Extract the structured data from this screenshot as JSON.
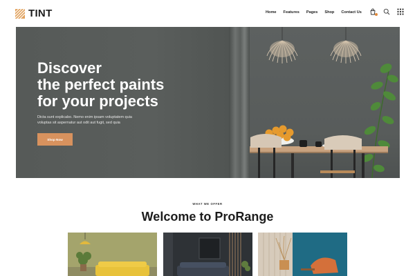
{
  "header": {
    "logo_text": "TINT",
    "nav": [
      "Home",
      "Features",
      "Pages",
      "Shop",
      "Contact Us"
    ],
    "icons": [
      "shopping-bag-icon",
      "search-icon",
      "grid-menu-icon"
    ]
  },
  "hero": {
    "title_lines": [
      "Discover",
      "the perfect paints",
      "for your projects"
    ],
    "description_lines": [
      "Dicta sunt explicabo. Nemo enim ipsam voluptatem quia",
      "voluptas sit aspernatur aut odit aut fugit, sed quia"
    ],
    "button_label": "Shop Now"
  },
  "offer": {
    "eyebrow": "WHAT WE OFFER",
    "title": "Welcome to ProRange"
  },
  "colors": {
    "accent": "#d8925e",
    "hero_wall": "#595d5b",
    "text_dark": "#1c1c1c"
  }
}
